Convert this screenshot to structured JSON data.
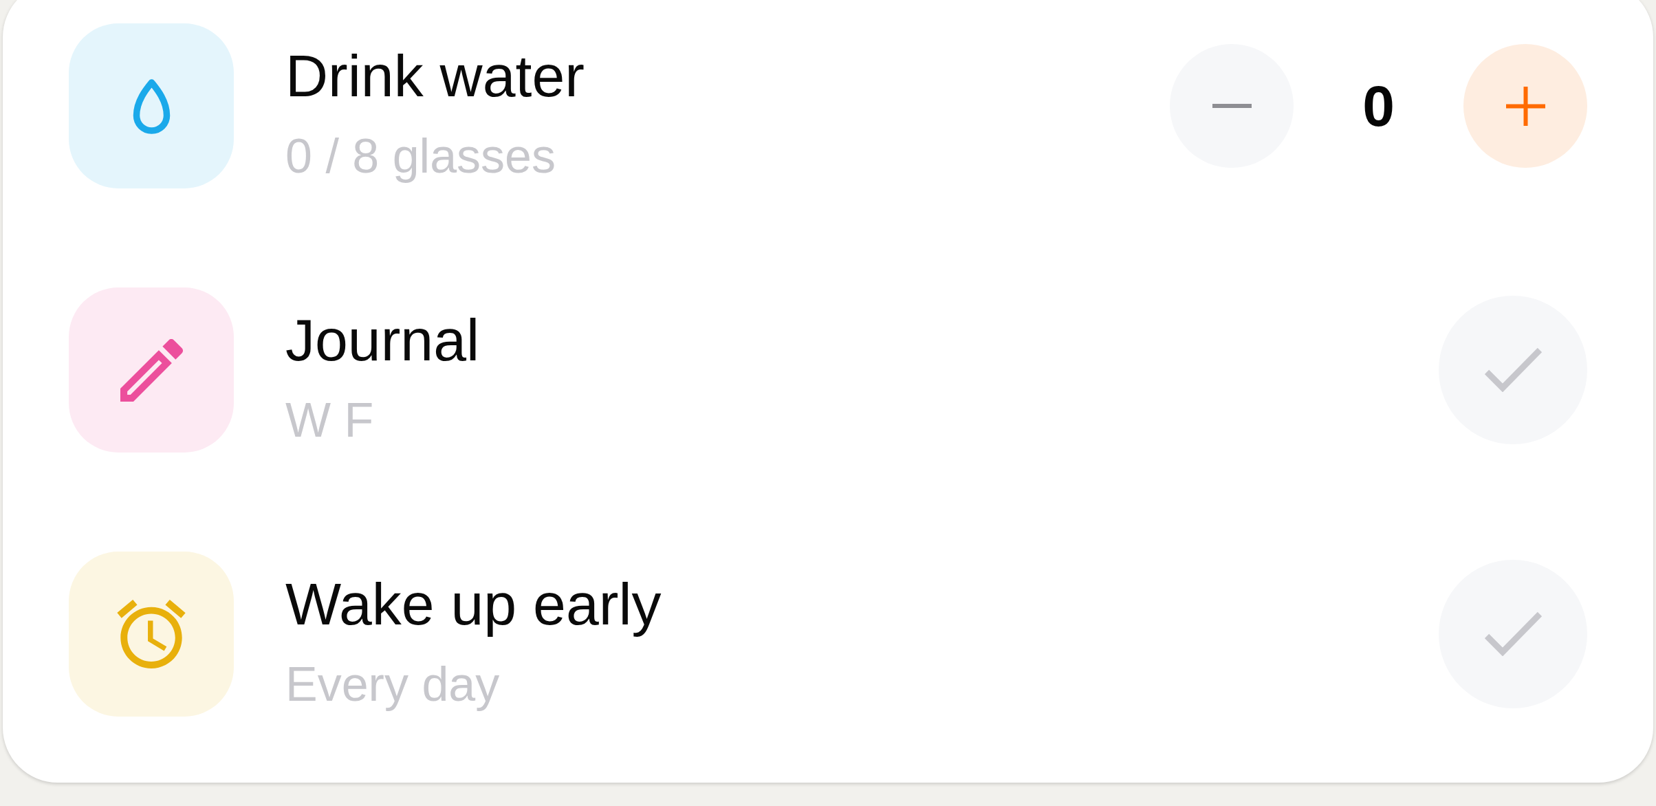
{
  "habits": [
    {
      "kind": "counter",
      "title": "Drink water",
      "detail": "0 / 8 glasses",
      "color": "#1aa9ea",
      "count": "0"
    },
    {
      "kind": "check",
      "title": "Journal",
      "detail": "W F",
      "color": "#ec4f9c",
      "done": false
    },
    {
      "kind": "check",
      "title": "Wake up early",
      "detail": "Every day",
      "color": "#e8b00c",
      "done": false
    }
  ]
}
